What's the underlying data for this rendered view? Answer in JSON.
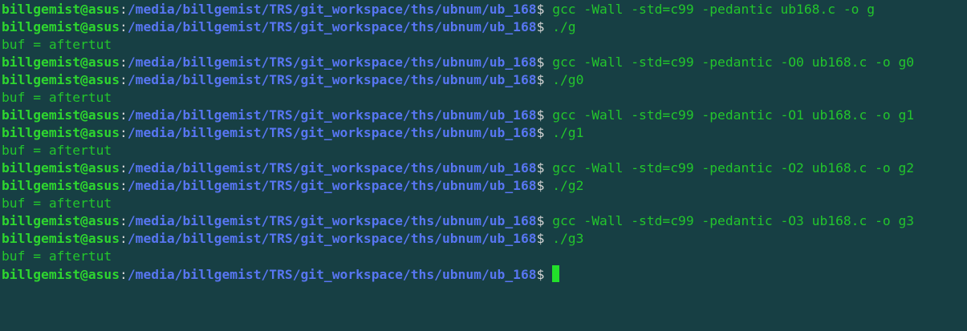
{
  "prompt": {
    "user_host": "billgemist@asus",
    "separator": ":",
    "path": "/media/billgemist/TRS/git_workspace/ths/ubnum/ub_168",
    "symbol": "$"
  },
  "colors": {
    "background": "#173f44",
    "user_host": "#2ed62f",
    "path": "#5876f2",
    "command": "#23c52c",
    "cursor": "#22e02a"
  },
  "lines": [
    {
      "type": "prompt",
      "command": " gcc -Wall -std=c99 -pedantic ub168.c -o g"
    },
    {
      "type": "prompt",
      "command": " ./g"
    },
    {
      "type": "output",
      "text": "buf = aftertut"
    },
    {
      "type": "prompt",
      "command": " gcc -Wall -std=c99 -pedantic -O0 ub168.c -o g0"
    },
    {
      "type": "prompt",
      "command": " ./g0"
    },
    {
      "type": "output",
      "text": "buf = aftertut"
    },
    {
      "type": "prompt",
      "command": " gcc -Wall -std=c99 -pedantic -O1 ub168.c -o g1"
    },
    {
      "type": "prompt",
      "command": " ./g1"
    },
    {
      "type": "output",
      "text": "buf = aftertut"
    },
    {
      "type": "prompt",
      "command": " gcc -Wall -std=c99 -pedantic -O2 ub168.c -o g2"
    },
    {
      "type": "prompt",
      "command": " ./g2"
    },
    {
      "type": "output",
      "text": "buf = aftertut"
    },
    {
      "type": "prompt",
      "command": " gcc -Wall -std=c99 -pedantic -O3 ub168.c -o g3"
    },
    {
      "type": "prompt",
      "command": " ./g3"
    },
    {
      "type": "output",
      "text": "buf = aftertut"
    },
    {
      "type": "prompt",
      "command": " "
    }
  ]
}
